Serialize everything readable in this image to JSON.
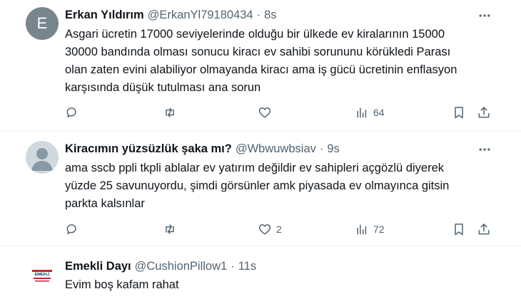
{
  "tweets": [
    {
      "avatar_letter": "E",
      "name": "Erkan Yıldırım",
      "handle": "@ErkanYl79180434",
      "separator": "·",
      "time": "8s",
      "text_lines": [
        "Asgari ücretin 17000 seviyelerinde olduğu bir ülkede ev kiralarının 15000",
        "30000 bandında olması sonucu kiracı ev sahibi sorununu körükledi Parası",
        "olan zaten evini alabiliyor olmayanda kiracı ama iş gücü ücretinin enflasyon",
        "karşısında düşük tutulması ana sorun"
      ],
      "reply_count": "",
      "retweet_count": "",
      "like_count": "",
      "view_count": "64"
    },
    {
      "name": "Kiracımın yüzsüzlük şaka mı?",
      "handle": "@Wbwuwbsiav",
      "separator": "·",
      "time": "9s",
      "text_lines": [
        "ama sscb ppli tkpli ablalar ev yatırım değildir ev sahipleri açgözlü diyerek",
        "yüzde 25 savunuyordu, şimdi görsünler amk piyasada ev olmayınca gitsin",
        "parkta kalsınlar"
      ],
      "reply_count": "",
      "retweet_count": "",
      "like_count": "2",
      "view_count": "72"
    },
    {
      "avatar_text": "EMEKLİ",
      "name": "Emekli Dayı",
      "handle": "@CushionPillow1",
      "separator": "·",
      "time": "11s",
      "text_lines": [
        "Evim boş kafam rahat"
      ]
    }
  ],
  "icons": {
    "reply": "reply-icon",
    "retweet": "retweet-icon",
    "like": "like-icon",
    "views": "views-icon",
    "bookmark": "bookmark-icon",
    "share": "share-icon",
    "more": "more-icon"
  },
  "colors": {
    "text": "#0f1419",
    "secondary": "#536471",
    "divider": "#eff3f4",
    "avatar_e": "#77858f",
    "avatar_default": "#cfd9de"
  }
}
